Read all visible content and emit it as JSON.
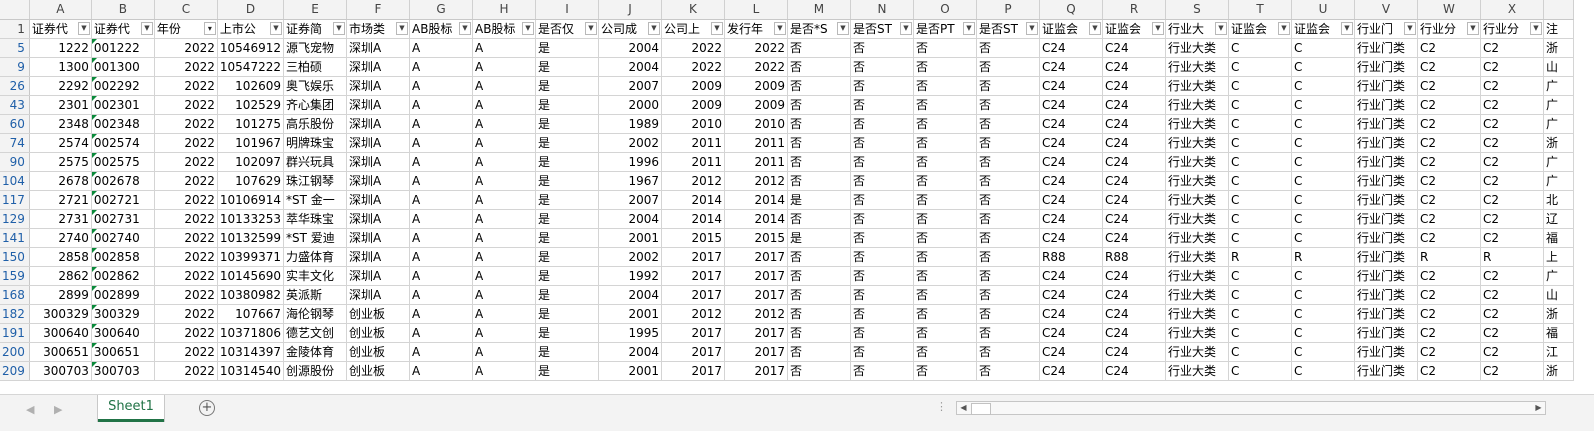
{
  "sheet": {
    "columns": [
      "A",
      "B",
      "C",
      "D",
      "E",
      "F",
      "G",
      "H",
      "I",
      "J",
      "K",
      "L",
      "M",
      "N",
      "O",
      "P",
      "Q",
      "R",
      "S",
      "T",
      "U",
      "V",
      "W",
      "X"
    ],
    "header_row_number": "1",
    "headers": [
      "证券代",
      "证券代",
      "年份",
      "上市公",
      "证券简",
      "市场类",
      "AB股标",
      "AB股标",
      "是否仅",
      "公司成",
      "公司上",
      "发行年",
      "是否*S",
      "是否ST",
      "是否PT",
      "是否ST",
      "证监会",
      "证监会",
      "行业大",
      "证监会",
      "证监会",
      "行业门",
      "行业分",
      "行业分"
    ],
    "extra_column_header": "注",
    "row_numbers": [
      "5",
      "9",
      "26",
      "43",
      "60",
      "74",
      "90",
      "104",
      "117",
      "129",
      "141",
      "150",
      "159",
      "168",
      "182",
      "191",
      "200",
      "209"
    ],
    "rows": [
      [
        "1222",
        "001222",
        "2022",
        "10546912",
        "源飞宠物",
        "深圳A",
        "A",
        "A",
        "是",
        "2004",
        "2022",
        "2022",
        "否",
        "否",
        "否",
        "否",
        "C24",
        "C24",
        "行业大类",
        "C",
        "C",
        "行业门类",
        "C2",
        "C2"
      ],
      [
        "1300",
        "001300",
        "2022",
        "10547222",
        "三柏硕",
        "深圳A",
        "A",
        "A",
        "是",
        "2004",
        "2022",
        "2022",
        "否",
        "否",
        "否",
        "否",
        "C24",
        "C24",
        "行业大类",
        "C",
        "C",
        "行业门类",
        "C2",
        "C2"
      ],
      [
        "2292",
        "002292",
        "2022",
        "102609",
        "奥飞娱乐",
        "深圳A",
        "A",
        "A",
        "是",
        "2007",
        "2009",
        "2009",
        "否",
        "否",
        "否",
        "否",
        "C24",
        "C24",
        "行业大类",
        "C",
        "C",
        "行业门类",
        "C2",
        "C2"
      ],
      [
        "2301",
        "002301",
        "2022",
        "102529",
        "齐心集团",
        "深圳A",
        "A",
        "A",
        "是",
        "2000",
        "2009",
        "2009",
        "否",
        "否",
        "否",
        "否",
        "C24",
        "C24",
        "行业大类",
        "C",
        "C",
        "行业门类",
        "C2",
        "C2"
      ],
      [
        "2348",
        "002348",
        "2022",
        "101275",
        "高乐股份",
        "深圳A",
        "A",
        "A",
        "是",
        "1989",
        "2010",
        "2010",
        "否",
        "否",
        "否",
        "否",
        "C24",
        "C24",
        "行业大类",
        "C",
        "C",
        "行业门类",
        "C2",
        "C2"
      ],
      [
        "2574",
        "002574",
        "2022",
        "101967",
        "明牌珠宝",
        "深圳A",
        "A",
        "A",
        "是",
        "2002",
        "2011",
        "2011",
        "否",
        "否",
        "否",
        "否",
        "C24",
        "C24",
        "行业大类",
        "C",
        "C",
        "行业门类",
        "C2",
        "C2"
      ],
      [
        "2575",
        "002575",
        "2022",
        "102097",
        "群兴玩具",
        "深圳A",
        "A",
        "A",
        "是",
        "1996",
        "2011",
        "2011",
        "否",
        "否",
        "否",
        "否",
        "C24",
        "C24",
        "行业大类",
        "C",
        "C",
        "行业门类",
        "C2",
        "C2"
      ],
      [
        "2678",
        "002678",
        "2022",
        "107629",
        "珠江钢琴",
        "深圳A",
        "A",
        "A",
        "是",
        "1967",
        "2012",
        "2012",
        "否",
        "否",
        "否",
        "否",
        "C24",
        "C24",
        "行业大类",
        "C",
        "C",
        "行业门类",
        "C2",
        "C2"
      ],
      [
        "2721",
        "002721",
        "2022",
        "10106914",
        "*ST 金一",
        "深圳A",
        "A",
        "A",
        "是",
        "2007",
        "2014",
        "2014",
        "是",
        "否",
        "否",
        "否",
        "C24",
        "C24",
        "行业大类",
        "C",
        "C",
        "行业门类",
        "C2",
        "C2"
      ],
      [
        "2731",
        "002731",
        "2022",
        "10133253",
        "萃华珠宝",
        "深圳A",
        "A",
        "A",
        "是",
        "2004",
        "2014",
        "2014",
        "否",
        "否",
        "否",
        "否",
        "C24",
        "C24",
        "行业大类",
        "C",
        "C",
        "行业门类",
        "C2",
        "C2"
      ],
      [
        "2740",
        "002740",
        "2022",
        "10132599",
        "*ST 爱迪",
        "深圳A",
        "A",
        "A",
        "是",
        "2001",
        "2015",
        "2015",
        "是",
        "否",
        "否",
        "否",
        "C24",
        "C24",
        "行业大类",
        "C",
        "C",
        "行业门类",
        "C2",
        "C2"
      ],
      [
        "2858",
        "002858",
        "2022",
        "10399371",
        "力盛体育",
        "深圳A",
        "A",
        "A",
        "是",
        "2002",
        "2017",
        "2017",
        "否",
        "否",
        "否",
        "否",
        "R88",
        "R88",
        "行业大类",
        "R",
        "R",
        "行业门类",
        "R",
        "R"
      ],
      [
        "2862",
        "002862",
        "2022",
        "10145690",
        "实丰文化",
        "深圳A",
        "A",
        "A",
        "是",
        "1992",
        "2017",
        "2017",
        "否",
        "否",
        "否",
        "否",
        "C24",
        "C24",
        "行业大类",
        "C",
        "C",
        "行业门类",
        "C2",
        "C2"
      ],
      [
        "2899",
        "002899",
        "2022",
        "10380982",
        "英派斯",
        "深圳A",
        "A",
        "A",
        "是",
        "2004",
        "2017",
        "2017",
        "否",
        "否",
        "否",
        "否",
        "C24",
        "C24",
        "行业大类",
        "C",
        "C",
        "行业门类",
        "C2",
        "C2"
      ],
      [
        "300329",
        "300329",
        "2022",
        "107667",
        "海伦钢琴",
        "创业板",
        "A",
        "A",
        "是",
        "2001",
        "2012",
        "2012",
        "否",
        "否",
        "否",
        "否",
        "C24",
        "C24",
        "行业大类",
        "C",
        "C",
        "行业门类",
        "C2",
        "C2"
      ],
      [
        "300640",
        "300640",
        "2022",
        "10371806",
        "德艺文创",
        "创业板",
        "A",
        "A",
        "是",
        "1995",
        "2017",
        "2017",
        "否",
        "否",
        "否",
        "否",
        "C24",
        "C24",
        "行业大类",
        "C",
        "C",
        "行业门类",
        "C2",
        "C2"
      ],
      [
        "300651",
        "300651",
        "2022",
        "10314397",
        "金陵体育",
        "创业板",
        "A",
        "A",
        "是",
        "2004",
        "2017",
        "2017",
        "否",
        "否",
        "否",
        "否",
        "C24",
        "C24",
        "行业大类",
        "C",
        "C",
        "行业门类",
        "C2",
        "C2"
      ],
      [
        "300703",
        "300703",
        "2022",
        "10314540",
        "创源股份",
        "创业板",
        "A",
        "A",
        "是",
        "2001",
        "2017",
        "2017",
        "否",
        "否",
        "否",
        "否",
        "C24",
        "C24",
        "行业大类",
        "C",
        "C",
        "行业门类",
        "C2",
        "C2"
      ]
    ],
    "extra_column_values": [
      "浙",
      "山",
      "广",
      "广",
      "广",
      "浙",
      "广",
      "广",
      "北",
      "辽",
      "福",
      "上",
      "广",
      "山",
      "浙",
      "福",
      "江",
      "浙"
    ]
  },
  "tabs": {
    "active_sheet": "Sheet1",
    "add_sheet_symbol": "+"
  },
  "colors": {
    "accent": "#217346",
    "row_header_text": "#1f5fa8",
    "text_marker": "#0a8a3a"
  }
}
